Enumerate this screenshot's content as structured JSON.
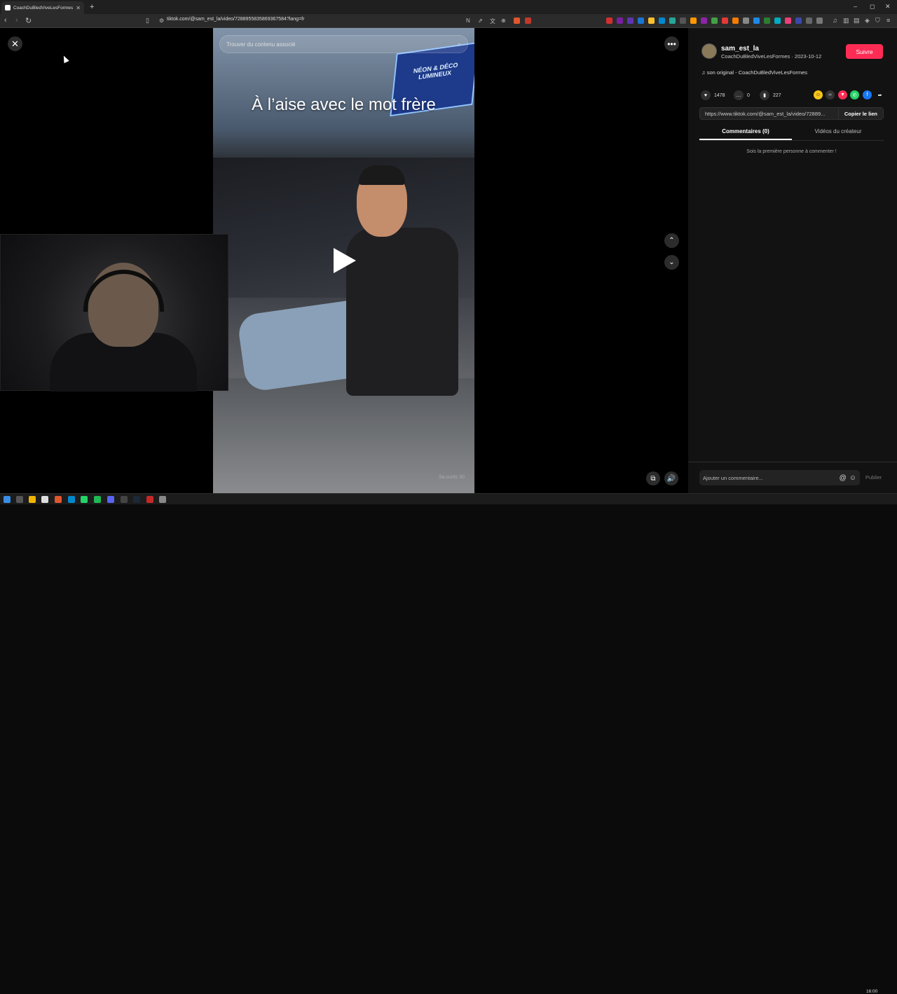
{
  "browser": {
    "tab_title": "CoachDuBledViveLesFormes",
    "tab_close": "✕",
    "new_tab": "+",
    "url": "tiktok.com/@sam_est_la/video/7288955835869367584?lang=fr"
  },
  "viewer": {
    "close_icon": "✕",
    "more_icon": "•••",
    "search_placeholder": "Trouver du contenu associé",
    "caption": "À l’aise avec le mot frère",
    "watermark": "Sa.curtis 30",
    "nav_up": "⌃",
    "nav_down": "⌄",
    "volume_icon": "🔊",
    "pip_icon": "⧉"
  },
  "post": {
    "username": "sam_est_la",
    "meta": "CoachDuBledViveLesFormes · 2023-10-12",
    "follow_label": "Suivre",
    "music": "son original - CoachDuBledViveLesFormes",
    "likes": "1478",
    "comments": "0",
    "saves": "227",
    "link": "https://www.tiktok.com/@sam_est_la/video/72889...",
    "copy_link_label": "Copier le lien",
    "share_icons": [
      "embed-icon",
      "code-icon",
      "tiktok-icon",
      "whatsapp-icon",
      "facebook-icon",
      "share-arrow-icon"
    ]
  },
  "tabs": {
    "comments": "Commentaires (0)",
    "creator_videos": "Vidéos du créateur"
  },
  "comments": {
    "empty": "Sois la première personne à commenter !",
    "input_placeholder": "Ajouter un commentaire...",
    "publish_label": "Publier"
  },
  "taskbar": {
    "clock": "16:00"
  },
  "colors": {
    "accent": "#fe2c55",
    "panel": "#121212"
  }
}
